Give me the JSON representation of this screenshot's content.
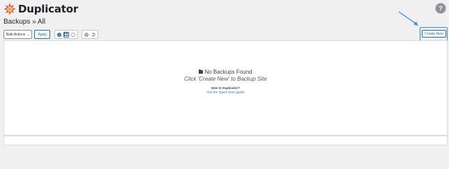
{
  "brand": {
    "name": "Duplicator"
  },
  "header": {
    "title": "Backups » All",
    "help_symbol": "?"
  },
  "toolbar": {
    "bulk_actions_label": "Bulk Actions",
    "apply_label": "Apply",
    "icon_buttons": [
      {
        "icon": "info-circle-icon"
      },
      {
        "icon": "grid-icon"
      },
      {
        "icon": "dollar-icon"
      },
      {
        "icon": "gear-icon"
      },
      {
        "icon": "history-icon"
      }
    ],
    "create_new_label": "Create New"
  },
  "empty_state": {
    "title": "No Backups Found",
    "subtitle": "Click 'Create New' to Backup Site",
    "new_prompt": "New to Duplicator?",
    "guide_link": "Visit the 'Quick Start' guide!"
  },
  "colors": {
    "accent": "#2271b1",
    "highlight": "#2d8ee8",
    "logo_orange": "#e8552a"
  }
}
